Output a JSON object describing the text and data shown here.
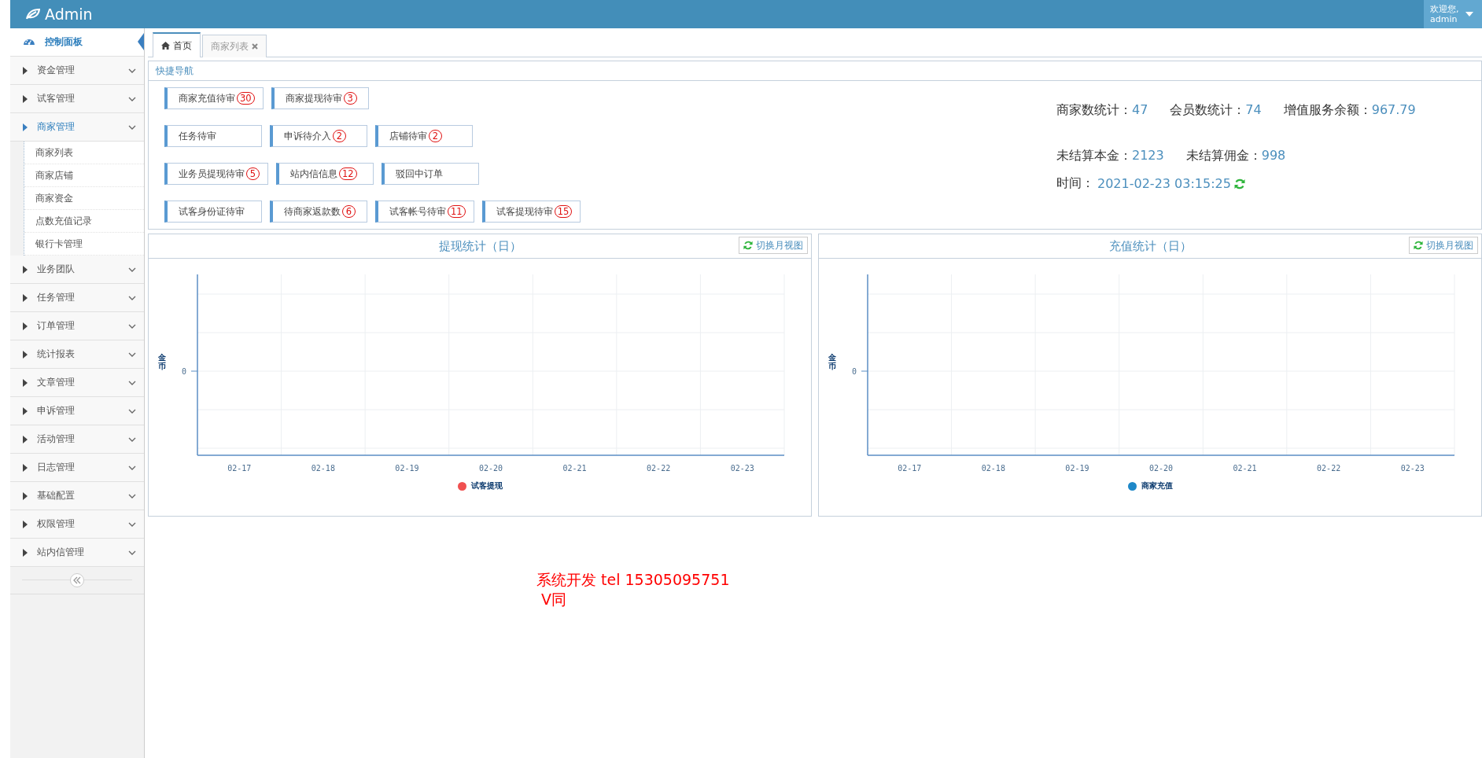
{
  "header": {
    "logo": "Admin",
    "welcome": "欢迎您,",
    "user": "admin"
  },
  "sidebar": {
    "items": [
      {
        "label": "控制面板",
        "kind": "dashboard",
        "selected": true,
        "expanded": false
      },
      {
        "label": "资金管理",
        "kind": "group",
        "selected": false,
        "expanded": false
      },
      {
        "label": "试客管理",
        "kind": "group",
        "selected": false,
        "expanded": false
      },
      {
        "label": "商家管理",
        "kind": "group",
        "selected": false,
        "expanded": true,
        "children": [
          {
            "label": "商家列表"
          },
          {
            "label": "商家店铺"
          },
          {
            "label": "商家资金"
          },
          {
            "label": "点数充值记录"
          },
          {
            "label": "银行卡管理"
          }
        ]
      },
      {
        "label": "业务团队",
        "kind": "group",
        "selected": false,
        "expanded": false
      },
      {
        "label": "任务管理",
        "kind": "group",
        "selected": false,
        "expanded": false
      },
      {
        "label": "订单管理",
        "kind": "group",
        "selected": false,
        "expanded": false
      },
      {
        "label": "统计报表",
        "kind": "group",
        "selected": false,
        "expanded": false
      },
      {
        "label": "文章管理",
        "kind": "group",
        "selected": false,
        "expanded": false
      },
      {
        "label": "申诉管理",
        "kind": "group",
        "selected": false,
        "expanded": false
      },
      {
        "label": "活动管理",
        "kind": "group",
        "selected": false,
        "expanded": false
      },
      {
        "label": "日志管理",
        "kind": "group",
        "selected": false,
        "expanded": false
      },
      {
        "label": "基础配置",
        "kind": "group",
        "selected": false,
        "expanded": false
      },
      {
        "label": "权限管理",
        "kind": "group",
        "selected": false,
        "expanded": false
      },
      {
        "label": "站内信管理",
        "kind": "group",
        "selected": false,
        "expanded": false
      }
    ]
  },
  "tabs": [
    {
      "label": "首页",
      "kind": "home",
      "selected": true
    },
    {
      "label": "商家列表",
      "kind": "closable",
      "selected": false
    }
  ],
  "quick_nav": {
    "title": "快捷导航",
    "rows": [
      [
        {
          "label": "商家充值待审",
          "count": "30"
        },
        {
          "label": "商家提现待审",
          "count": "3"
        }
      ],
      [
        {
          "label": "任务待审"
        },
        {
          "label": "申诉待介入",
          "count": "2"
        },
        {
          "label": "店铺待审",
          "count": "2"
        }
      ],
      [
        {
          "label": "业务员提现待审",
          "count": "5"
        },
        {
          "label": "站内信信息",
          "count": "12"
        },
        {
          "label": "驳回中订单"
        }
      ],
      [
        {
          "label": "试客身份证待审"
        },
        {
          "label": "待商家返款数",
          "count": "6"
        },
        {
          "label": "试客帐号待审",
          "count": "11"
        },
        {
          "label": "试客提现待审",
          "count": "15"
        }
      ]
    ]
  },
  "stats": {
    "rows": [
      [
        {
          "label": "商家数统计：",
          "value": "47"
        },
        {
          "label": "会员数统计：",
          "value": "74"
        },
        {
          "label": "增值服务余额：",
          "value": "967.79"
        }
      ],
      [
        {
          "label": "未结算本金：",
          "value": "2123"
        },
        {
          "label": "未结算佣金：",
          "value": "998"
        }
      ]
    ],
    "time_label": "时间：",
    "time": "2021-02-23 03:15:25"
  },
  "charts": [
    {
      "title": "提现统计（日）",
      "switch_button": "切换月视图",
      "y_axis_title": "金币",
      "y_tick": "0",
      "x_labels": [
        "02-17",
        "02-18",
        "02-19",
        "02-20",
        "02-21",
        "02-22",
        "02-23"
      ],
      "legend": [
        {
          "name": "试客提现",
          "color": "#f05050"
        }
      ]
    },
    {
      "title": "充值统计（日）",
      "switch_button": "切换月视图",
      "y_axis_title": "金币",
      "y_tick": "0",
      "x_labels": [
        "02-17",
        "02-18",
        "02-19",
        "02-20",
        "02-21",
        "02-22",
        "02-23"
      ],
      "legend": [
        {
          "name": "商家充值",
          "color": "#1e88c8"
        }
      ]
    }
  ],
  "notice": [
    "系统开发 tel 15305095751",
    "V同"
  ]
}
